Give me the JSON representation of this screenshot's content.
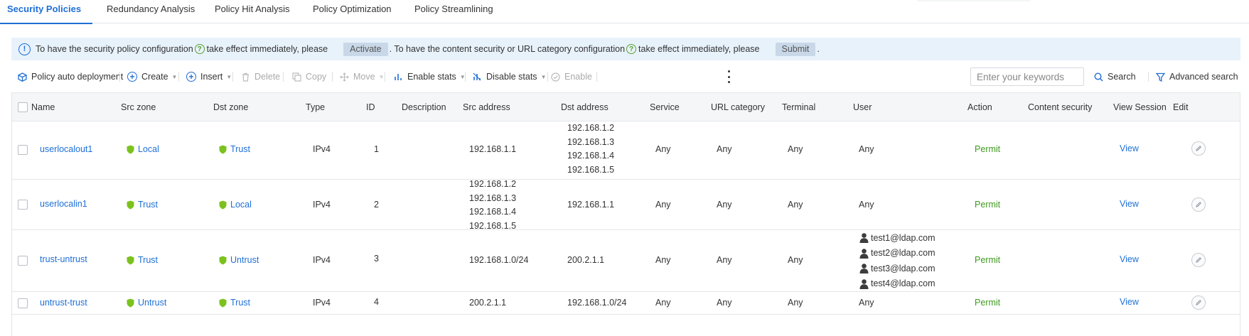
{
  "tabs": [
    {
      "label": "Security Policies",
      "active": true
    },
    {
      "label": "Redundancy Analysis",
      "active": false
    },
    {
      "label": "Policy Hit Analysis",
      "active": false
    },
    {
      "label": "Policy Optimization",
      "active": false
    },
    {
      "label": "Policy Streamlining",
      "active": false
    }
  ],
  "banner": {
    "text1": "To have the security policy configuration",
    "text2": "take effect immediately, please",
    "activate_label": "Activate",
    "text3": ". To have the content security or URL category configuration",
    "text4": "take effect immediately, please",
    "submit_label": "Submit",
    "text5": "."
  },
  "toolbar": {
    "auto_deploy": "Policy auto deployment",
    "create": "Create",
    "insert": "Insert",
    "delete": "Delete",
    "copy": "Copy",
    "move": "Move",
    "enable_stats": "Enable stats",
    "disable_stats": "Disable stats",
    "enable": "Enable",
    "search_placeholder": "Enter your keywords",
    "search": "Search",
    "advanced_search": "Advanced search"
  },
  "columns": [
    "Name",
    "Src zone",
    "Dst zone",
    "Type",
    "ID",
    "Description",
    "Src address",
    "Dst address",
    "Service",
    "URL category",
    "Terminal",
    "User",
    "Action",
    "Content security",
    "View Session",
    "Edit"
  ],
  "rows": [
    {
      "name": "userlocalout1",
      "src_zone": "Local",
      "dst_zone": "Trust",
      "type": "IPv4",
      "id": "1",
      "description": "",
      "src_address": [
        "192.168.1.1"
      ],
      "dst_address": [
        "192.168.1.2",
        "192.168.1.3",
        "192.168.1.4",
        "192.168.1.5"
      ],
      "service": "Any",
      "url_category": "Any",
      "terminal": "Any",
      "user": [
        "Any"
      ],
      "action": "Permit",
      "content_security": "",
      "view": "View"
    },
    {
      "name": "userlocalin1",
      "src_zone": "Trust",
      "dst_zone": "Local",
      "type": "IPv4",
      "id": "2",
      "description": "",
      "src_address": [
        "192.168.1.2",
        "192.168.1.3",
        "192.168.1.4",
        "192.168.1.5"
      ],
      "dst_address": [
        "192.168.1.1"
      ],
      "service": "Any",
      "url_category": "Any",
      "terminal": "Any",
      "user": [
        "Any"
      ],
      "action": "Permit",
      "content_security": "",
      "view": "View"
    },
    {
      "name": "trust-untrust",
      "src_zone": "Trust",
      "dst_zone": "Untrust",
      "type": "IPv4",
      "id": "3",
      "description": "",
      "src_address": [
        "192.168.1.0/24"
      ],
      "dst_address": [
        "200.2.1.1"
      ],
      "service": "Any",
      "url_category": "Any",
      "terminal": "Any",
      "user": [
        "test1@ldap.com",
        "test2@ldap.com",
        "test3@ldap.com",
        "test4@ldap.com"
      ],
      "action": "Permit",
      "content_security": "",
      "view": "View"
    },
    {
      "name": "untrust-trust",
      "src_zone": "Untrust",
      "dst_zone": "Trust",
      "type": "IPv4",
      "id": "4",
      "description": "",
      "src_address": [
        "200.2.1.1"
      ],
      "dst_address": [
        "192.168.1.0/24"
      ],
      "service": "Any",
      "url_category": "Any",
      "terminal": "Any",
      "user": [
        "Any"
      ],
      "action": "Permit",
      "content_security": "",
      "view": "View"
    }
  ],
  "colors": {
    "accent": "#1f6fd6",
    "permit": "#3f9a1f",
    "shield": "#7cc21e",
    "banner_bg": "#e8f2fb"
  },
  "icons": [
    "info-icon",
    "help-icon",
    "deploy-icon",
    "plus-circle-icon",
    "trash-icon",
    "copy-icon",
    "move-icon",
    "stats-icon",
    "disable-stats-icon",
    "check-circle-icon",
    "more-icon",
    "search-icon",
    "filter-icon",
    "shield-icon",
    "user-icon",
    "edit-icon"
  ]
}
